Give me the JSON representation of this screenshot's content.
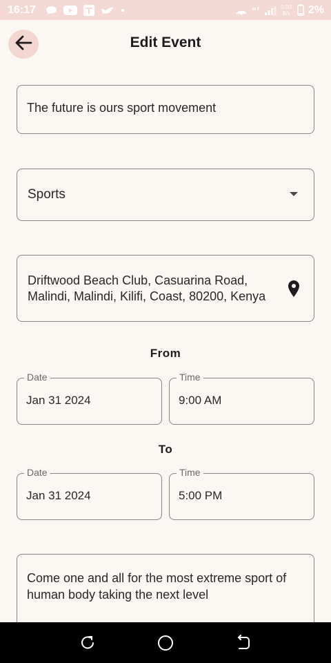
{
  "status_bar": {
    "time": "16:17",
    "notification_icons": [
      "chat-bubble-icon",
      "youtube-icon",
      "t-app-icon",
      "bird-icon",
      "dot-icon"
    ],
    "net_speed_value": "0.00",
    "net_speed_unit": "B/s",
    "battery_percent": "2%"
  },
  "header": {
    "back_icon": "arrow-left-icon",
    "title": "Edit Event"
  },
  "form": {
    "event_title": "The future is ours sport movement",
    "category": "Sports",
    "location_line1": "Driftwood Beach Club, Casuarina Road,",
    "location_line2": "Malindi, Malindi, Kilifi, Coast, 80200, Kenya",
    "from_label": "From",
    "to_label": "To",
    "from_date_label": "Date",
    "from_date_value": "Jan 31 2024",
    "from_time_label": "Time",
    "from_time_value": "9:00 AM",
    "to_date_label": "Date",
    "to_date_value": "Jan 31 2024",
    "to_time_label": "Time",
    "to_time_value": "5:00 PM",
    "description": "Come one and all for the most extreme sport of human body taking the next level"
  },
  "colors": {
    "background": "#fbf8f3",
    "status_bar": "#f3d8d3",
    "back_button_bg": "#f3d6d0",
    "field_border": "#8a8588"
  }
}
